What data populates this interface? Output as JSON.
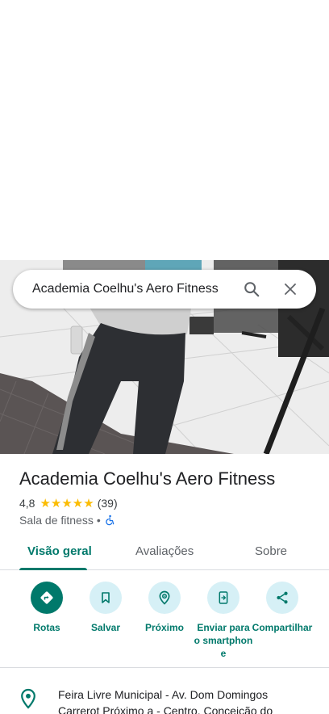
{
  "search": {
    "query": "Academia Coelhu's Aero Fitness"
  },
  "place": {
    "name": "Academia Coelhu's Aero Fitness",
    "rating": "4,8",
    "stars": "★★★★★",
    "review_count": "(39)",
    "category": "Sala de fitness",
    "separator": "•"
  },
  "tabs": [
    {
      "label": "Visão geral"
    },
    {
      "label": "Avaliações"
    },
    {
      "label": "Sobre"
    }
  ],
  "actions": [
    {
      "label": "Rotas",
      "icon": "directions-icon"
    },
    {
      "label": "Salvar",
      "icon": "bookmark-icon"
    },
    {
      "label": "Próximo",
      "icon": "nearby-icon"
    },
    {
      "label": "Enviar para o smartphone",
      "icon": "send-to-phone-icon"
    },
    {
      "label": "Compartilhar",
      "icon": "share-icon"
    }
  ],
  "address": {
    "text": "Feira Livre Municipal - Av. Dom Domingos Carrerot Próximo a - Centro, Conceição do"
  },
  "colors": {
    "accent": "#00796b",
    "accent_light": "#d6f0f6",
    "star": "#fbbc04",
    "accessibility": "#1a73e8"
  }
}
